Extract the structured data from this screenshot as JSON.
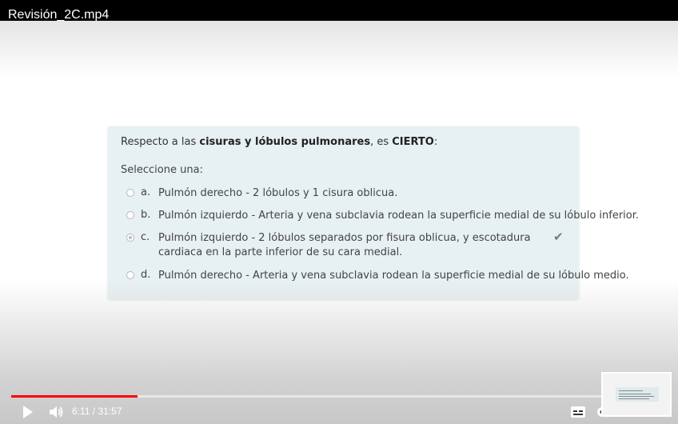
{
  "video": {
    "title": "Revisión_2C.mp4"
  },
  "quiz": {
    "question_parts": {
      "pre": "Respecto a las ",
      "bold1": "cisuras y lóbulos pulmonares",
      "mid": ", es ",
      "bold2": "CIERTO",
      "post": ":"
    },
    "prompt": "Seleccione una:",
    "options": [
      {
        "letter": "a.",
        "text": "Pulmón derecho - 2 lóbulos y 1 cisura oblicua.",
        "selected": false
      },
      {
        "letter": "b.",
        "text": "Pulmón izquierdo - Arteria y vena subclavia rodean la superficie medial de su lóbulo inferior.",
        "selected": false
      },
      {
        "letter": "c.",
        "text": "Pulmón izquierdo - 2 lóbulos separados por fisura oblicua, y escotadura cardiaca en la parte inferior de su cara medial.",
        "selected": true
      },
      {
        "letter": "d.",
        "text": "Pulmón derecho - Arteria y vena subclavia rodean la superficie medial de su lóbulo medio.",
        "selected": false
      }
    ],
    "correct_icon": "checkmark-icon"
  },
  "player": {
    "time_display": "6:11 / 31:57",
    "progress_fraction": 0.193,
    "progress_color": "#ff0000",
    "icons": {
      "play": "play-icon",
      "volume": "volume-icon",
      "captions": "captions-icon",
      "settings": "settings-icon"
    }
  }
}
